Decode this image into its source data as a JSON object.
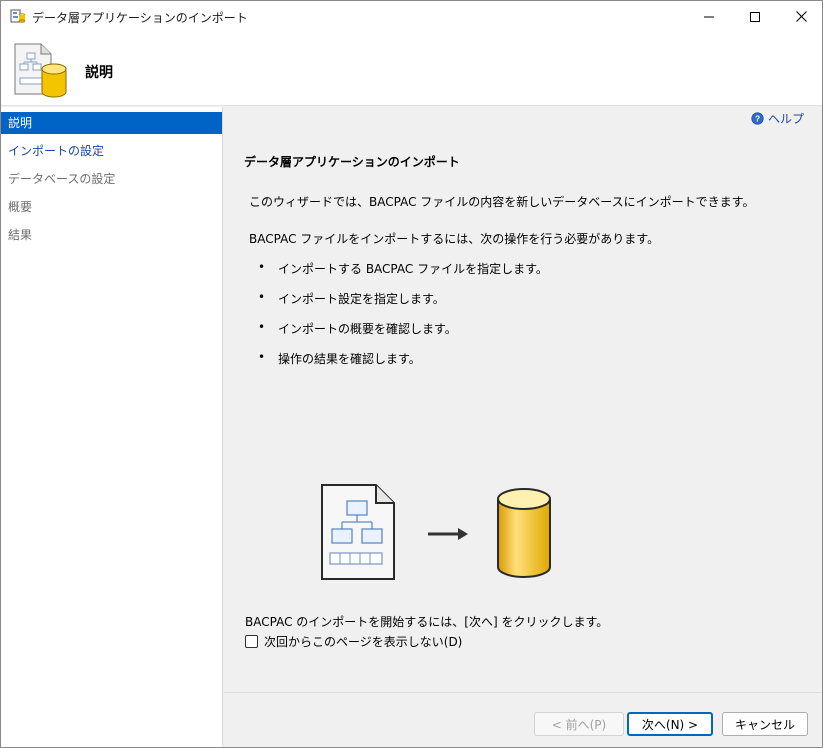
{
  "window": {
    "title": "データ層アプリケーションのインポート"
  },
  "banner": {
    "title": "説明"
  },
  "nav": {
    "items": [
      {
        "label": "説明",
        "state": "active"
      },
      {
        "label": "インポートの設定",
        "state": "link"
      },
      {
        "label": "データベースの設定",
        "state": "disabled"
      },
      {
        "label": "概要",
        "state": "disabled"
      },
      {
        "label": "結果",
        "state": "disabled"
      }
    ]
  },
  "main": {
    "help_label": "ヘルプ",
    "section_title": "データ層アプリケーションのインポート",
    "intro": "このウィザードでは、BACPAC ファイルの内容を新しいデータベースにインポートできます。",
    "requirements": "BACPAC ファイルをインポートするには、次の操作を行う必要があります。",
    "steps": [
      "インポートする BACPAC ファイルを指定します。",
      "インポート設定を指定します。",
      "インポートの概要を確認します。",
      "操作の結果を確認します。"
    ],
    "start_text": "BACPAC のインポートを開始するには、[次へ] をクリックします。",
    "skip_checkbox_label": "次回からこのページを表示しない(D)",
    "skip_checkbox_checked": false
  },
  "footer": {
    "back_label": "< 前へ(P)",
    "next_label": "次へ(N) >",
    "cancel_label": "キャンセル"
  },
  "icons": {
    "app": "data-tier-app-icon",
    "banner": "bacpac-database-icon",
    "help": "help-icon",
    "illustration": [
      "bacpac-file-icon",
      "arrow-right-icon",
      "database-icon"
    ]
  },
  "colors": {
    "accent": "#0063c6",
    "link": "#1b46a8",
    "disabled": "#6d6d6d",
    "database_yellow": "#f5c400"
  }
}
